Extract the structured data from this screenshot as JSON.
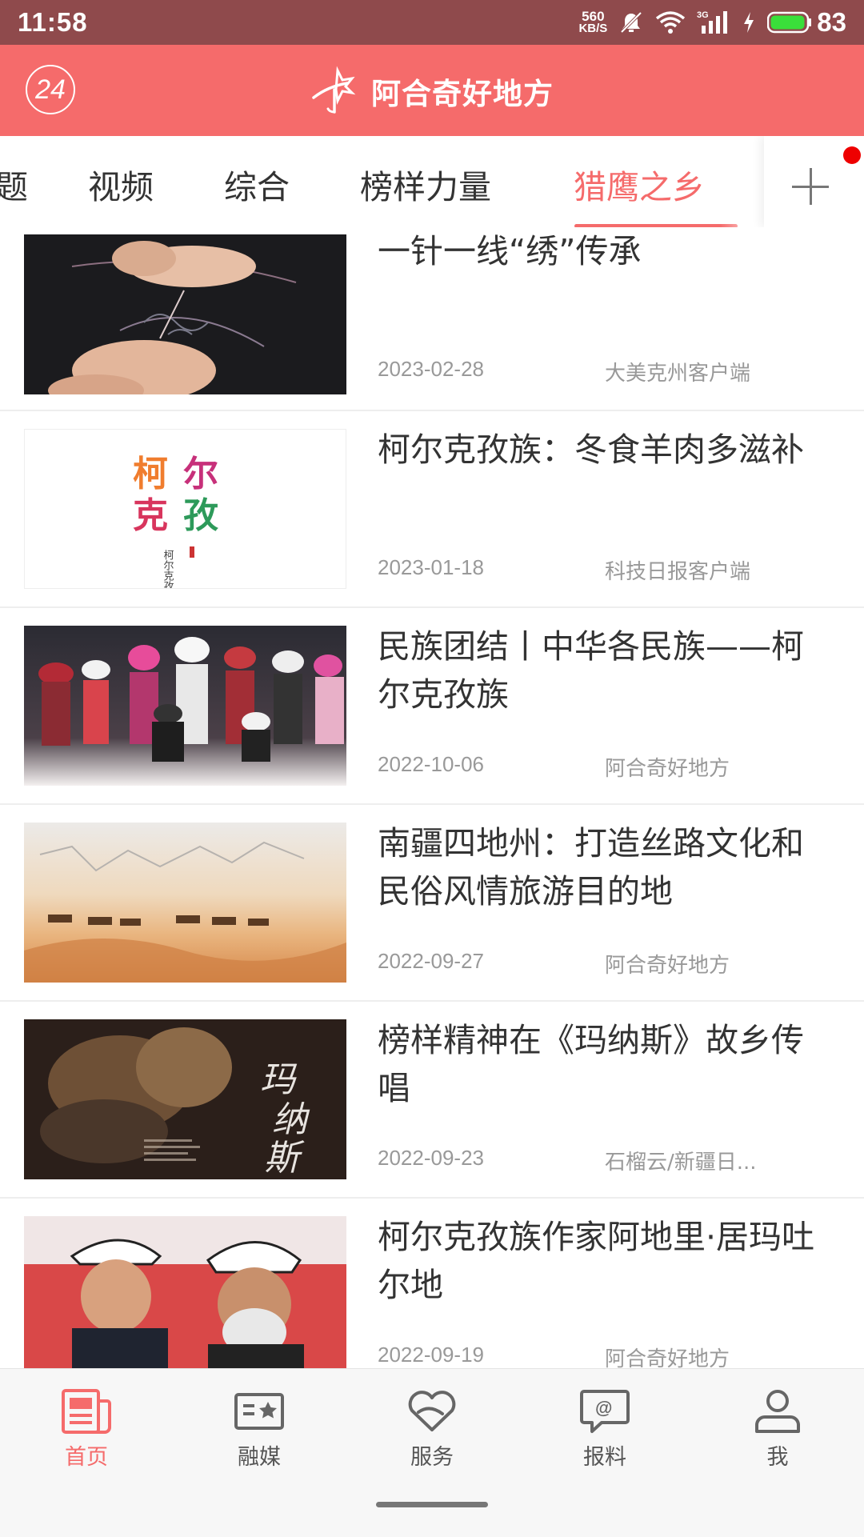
{
  "status_bar": {
    "time": "11:58",
    "net_speed_value": "560",
    "net_speed_unit": "KB/S",
    "signal_label": "3G",
    "battery": "83",
    "icons": [
      "mute-icon",
      "wifi-icon",
      "signal-icon",
      "charging-icon",
      "battery-icon"
    ]
  },
  "header": {
    "badge": "24",
    "title": "阿合奇好地方",
    "colors": {
      "brand": "#f56b6b",
      "status": "#8f4a4c"
    }
  },
  "tabs": {
    "items": [
      {
        "label": "题",
        "active": false
      },
      {
        "label": "视频",
        "active": false
      },
      {
        "label": "综合",
        "active": false
      },
      {
        "label": "榜样力量",
        "active": false
      },
      {
        "label": "猎鹰之乡",
        "active": true
      }
    ],
    "add_icon": "plus-icon"
  },
  "articles": [
    {
      "title": "一针一线“绣”传承",
      "date": "2023-02-28",
      "source": "大美克州客户端",
      "thumb": "embroidery-photo"
    },
    {
      "title": "柯尔克孜族：冬食羊肉多滋补",
      "date": "2023-01-18",
      "source": "科技日报客户端",
      "thumb": "kirgiz-logo",
      "thumb_text": "柯尔克孜"
    },
    {
      "title": "民族团结丨中华各民族——柯尔克孜族",
      "date": "2022-10-06",
      "source": "阿合奇好地方",
      "thumb": "people-group-photo"
    },
    {
      "title": "南疆四地州：打造丝路文化和民俗风情旅游目的地",
      "date": "2022-09-27",
      "source": "阿合奇好地方",
      "thumb": "camel-desert-photo"
    },
    {
      "title": "榜样精神在《玛纳斯》故乡传唱",
      "date": "2022-09-23",
      "source": "石榴云/新疆日...",
      "thumb": "manas-poster",
      "thumb_text": "玛纳斯"
    },
    {
      "title": "柯尔克孜族作家阿地里·居玛吐尔地",
      "date": "2022-09-19",
      "source": "阿合奇好地方",
      "thumb": "men-hats-photo"
    }
  ],
  "bottom_nav": [
    {
      "label": "首页",
      "icon": "news-icon",
      "active": true
    },
    {
      "label": "融媒",
      "icon": "media-card-icon",
      "active": false
    },
    {
      "label": "服务",
      "icon": "heart-hands-icon",
      "active": false
    },
    {
      "label": "报料",
      "icon": "chat-at-icon",
      "active": false
    },
    {
      "label": "我",
      "icon": "person-icon",
      "active": false
    }
  ]
}
